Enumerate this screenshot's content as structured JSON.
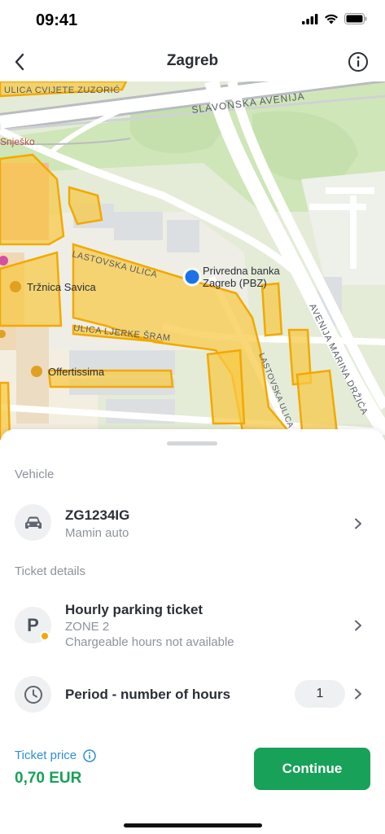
{
  "status_bar": {
    "time": "09:41"
  },
  "nav": {
    "title": "Zagreb"
  },
  "map": {
    "streets": {
      "cvijete_zuzoric": "ULICA CVIJETE ZUZORIĆ",
      "slavonska": "SLAVONSKA AVENIJA",
      "lastovska": "LASTOVSKA ULICA",
      "ljerke_sram": "ULICA LJERKE ŠRAM",
      "lastovska_vertical": "LASTOVSKA ULICA",
      "marina_drzica": "AVENIJA MARINA DRŽIĆA"
    },
    "places": {
      "snjesko": "Snješko",
      "trznica": "Tržnica Savica",
      "offertissima": "Offertissima",
      "bank_line1": "Privredna banka",
      "bank_line2": "Zagreb (PBZ)"
    }
  },
  "sheet": {
    "vehicle_section": "Vehicle",
    "vehicle": {
      "plate": "ZG1234IG",
      "name": "Mamin auto",
      "icon": "car-icon"
    },
    "ticket_section": "Ticket details",
    "ticket": {
      "title": "Hourly parking ticket",
      "zone": "ZONE 2",
      "note": "Chargeable hours not available",
      "badge_letter": "P",
      "icon": "parking-icon"
    },
    "period": {
      "title": "Period - number of hours",
      "value": "1",
      "icon": "clock-icon"
    },
    "price": {
      "label": "Ticket price",
      "value": "0,70 EUR"
    },
    "continue_label": "Continue"
  },
  "colors": {
    "accent_green": "#18a158",
    "link_blue": "#2d8fd5",
    "zone_yellow": "#f7c948",
    "location_blue": "#1a73e8"
  }
}
